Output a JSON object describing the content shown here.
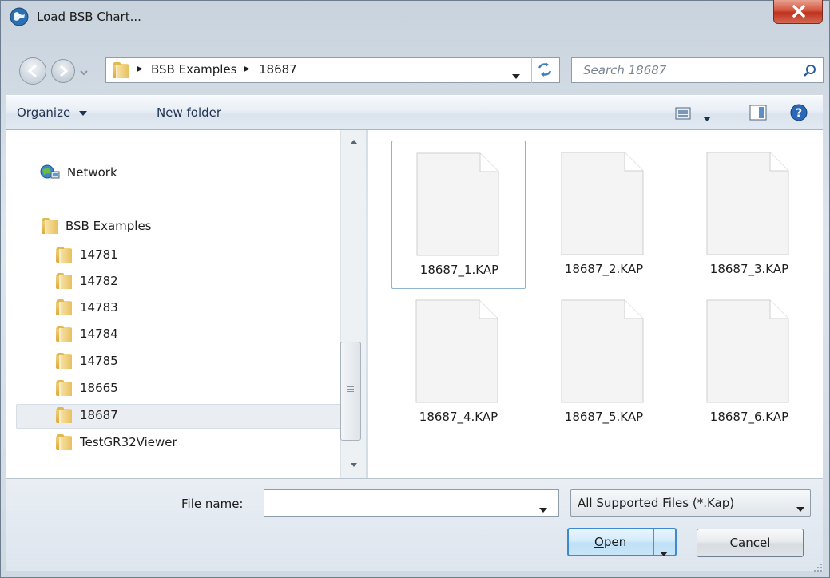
{
  "window": {
    "title": "Load BSB Chart..."
  },
  "address": {
    "crumbs": [
      "BSB Examples",
      "18687"
    ]
  },
  "search": {
    "placeholder": "Search 18687"
  },
  "toolbar": {
    "organize_label": "Organize",
    "new_folder_label": "New folder"
  },
  "nav": {
    "network_label": "Network",
    "root_folder": "BSB Examples",
    "folders": [
      "14781",
      "14782",
      "14783",
      "14784",
      "14785",
      "18665",
      "18687",
      "TestGR32Viewer"
    ],
    "selected_folder": "18687"
  },
  "files": [
    {
      "name": "18687_1.KAP",
      "selected": true
    },
    {
      "name": "18687_2.KAP",
      "selected": false
    },
    {
      "name": "18687_3.KAP",
      "selected": false
    },
    {
      "name": "18687_4.KAP",
      "selected": false
    },
    {
      "name": "18687_5.KAP",
      "selected": false
    },
    {
      "name": "18687_6.KAP",
      "selected": false
    }
  ],
  "bottom": {
    "file_name_label_pre": "File ",
    "file_name_label_accel": "n",
    "file_name_label_post": "ame:",
    "file_name_value": "",
    "filter_value": "All Supported Files (*.Kap)",
    "open_label_accel": "O",
    "open_label_rest": "pen",
    "cancel_label": "Cancel"
  },
  "colors": {
    "selection_border": "#8fb2cf",
    "close_red": "#c0301d",
    "open_focus": "#3e8ad0"
  }
}
